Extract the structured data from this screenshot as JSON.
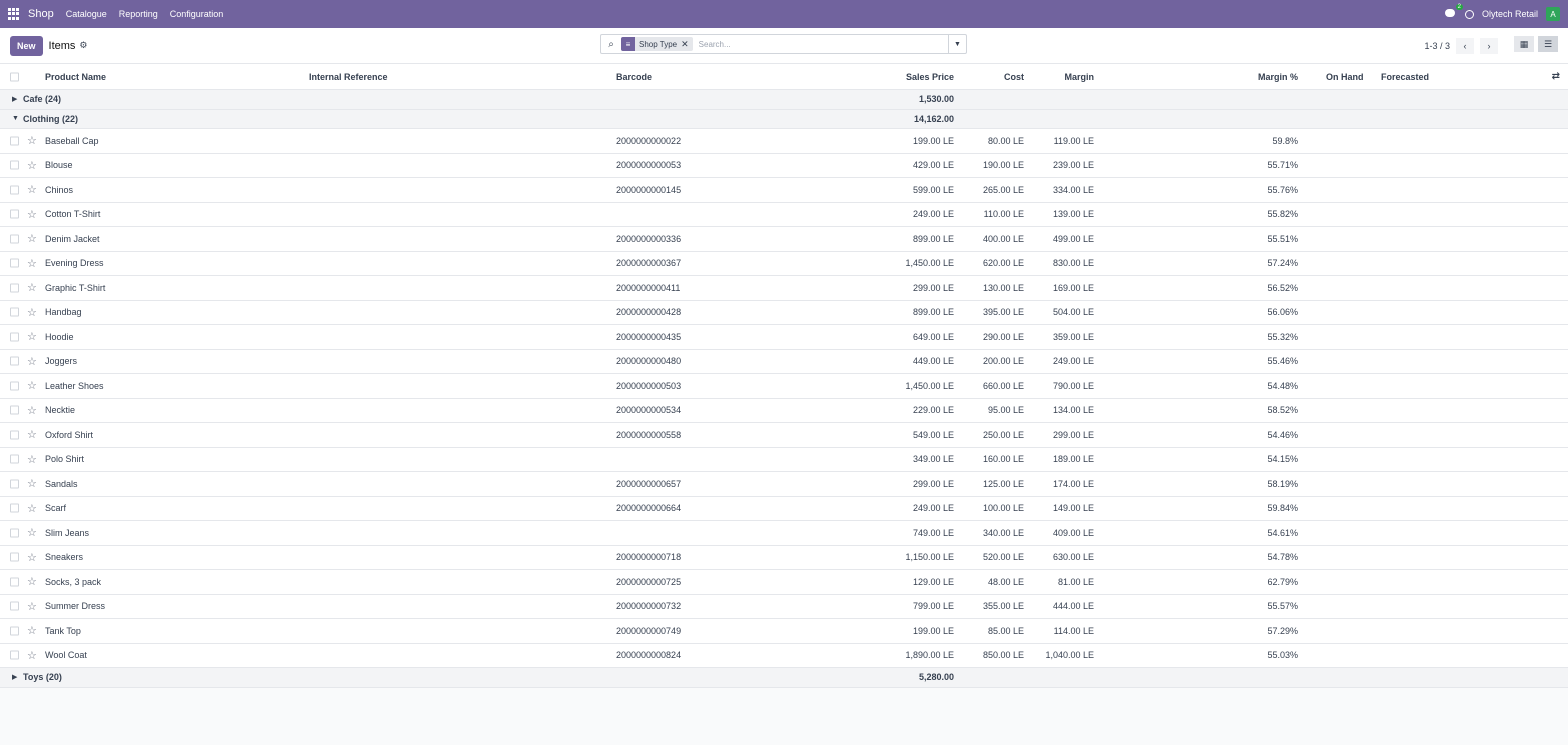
{
  "topbar": {
    "brand": "Shop",
    "menus": [
      "Catalogue",
      "Reporting",
      "Configuration"
    ],
    "chat_count": "2",
    "company": "Olytech Retail",
    "avatar_letter": "A"
  },
  "control": {
    "new_label": "New",
    "title": "Items",
    "facet_label": "Shop Type",
    "search_placeholder": "Search...",
    "pager": "1-3 / 3"
  },
  "columns": {
    "name": "Product Name",
    "ref": "Internal Reference",
    "barcode": "Barcode",
    "price": "Sales Price",
    "cost": "Cost",
    "margin": "Margin",
    "mpct": "Margin %",
    "onhand": "On Hand",
    "forecasted": "Forecasted"
  },
  "groups": [
    {
      "label": "Cafe (24)",
      "total": "1,530.00",
      "expanded": false
    },
    {
      "label": "Clothing (22)",
      "total": "14,162.00",
      "expanded": true
    },
    {
      "label": "Toys (20)",
      "total": "5,280.00",
      "expanded": false
    }
  ],
  "rows": [
    {
      "name": "Baseball Cap",
      "barcode": "2000000000022",
      "price": "199.00 LE",
      "cost": "80.00 LE",
      "margin": "119.00 LE",
      "mpct": "59.8%"
    },
    {
      "name": "Blouse",
      "barcode": "2000000000053",
      "price": "429.00 LE",
      "cost": "190.00 LE",
      "margin": "239.00 LE",
      "mpct": "55.71%"
    },
    {
      "name": "Chinos",
      "barcode": "2000000000145",
      "price": "599.00 LE",
      "cost": "265.00 LE",
      "margin": "334.00 LE",
      "mpct": "55.76%"
    },
    {
      "name": "Cotton T-Shirt",
      "barcode": "",
      "price": "249.00 LE",
      "cost": "110.00 LE",
      "margin": "139.00 LE",
      "mpct": "55.82%"
    },
    {
      "name": "Denim Jacket",
      "barcode": "2000000000336",
      "price": "899.00 LE",
      "cost": "400.00 LE",
      "margin": "499.00 LE",
      "mpct": "55.51%"
    },
    {
      "name": "Evening Dress",
      "barcode": "2000000000367",
      "price": "1,450.00 LE",
      "cost": "620.00 LE",
      "margin": "830.00 LE",
      "mpct": "57.24%"
    },
    {
      "name": "Graphic T-Shirt",
      "barcode": "2000000000411",
      "price": "299.00 LE",
      "cost": "130.00 LE",
      "margin": "169.00 LE",
      "mpct": "56.52%"
    },
    {
      "name": "Handbag",
      "barcode": "2000000000428",
      "price": "899.00 LE",
      "cost": "395.00 LE",
      "margin": "504.00 LE",
      "mpct": "56.06%"
    },
    {
      "name": "Hoodie",
      "barcode": "2000000000435",
      "price": "649.00 LE",
      "cost": "290.00 LE",
      "margin": "359.00 LE",
      "mpct": "55.32%"
    },
    {
      "name": "Joggers",
      "barcode": "2000000000480",
      "price": "449.00 LE",
      "cost": "200.00 LE",
      "margin": "249.00 LE",
      "mpct": "55.46%"
    },
    {
      "name": "Leather Shoes",
      "barcode": "2000000000503",
      "price": "1,450.00 LE",
      "cost": "660.00 LE",
      "margin": "790.00 LE",
      "mpct": "54.48%"
    },
    {
      "name": "Necktie",
      "barcode": "2000000000534",
      "price": "229.00 LE",
      "cost": "95.00 LE",
      "margin": "134.00 LE",
      "mpct": "58.52%"
    },
    {
      "name": "Oxford Shirt",
      "barcode": "2000000000558",
      "price": "549.00 LE",
      "cost": "250.00 LE",
      "margin": "299.00 LE",
      "mpct": "54.46%"
    },
    {
      "name": "Polo Shirt",
      "barcode": "",
      "price": "349.00 LE",
      "cost": "160.00 LE",
      "margin": "189.00 LE",
      "mpct": "54.15%"
    },
    {
      "name": "Sandals",
      "barcode": "2000000000657",
      "price": "299.00 LE",
      "cost": "125.00 LE",
      "margin": "174.00 LE",
      "mpct": "58.19%"
    },
    {
      "name": "Scarf",
      "barcode": "2000000000664",
      "price": "249.00 LE",
      "cost": "100.00 LE",
      "margin": "149.00 LE",
      "mpct": "59.84%"
    },
    {
      "name": "Slim Jeans",
      "barcode": "",
      "price": "749.00 LE",
      "cost": "340.00 LE",
      "margin": "409.00 LE",
      "mpct": "54.61%"
    },
    {
      "name": "Sneakers",
      "barcode": "2000000000718",
      "price": "1,150.00 LE",
      "cost": "520.00 LE",
      "margin": "630.00 LE",
      "mpct": "54.78%"
    },
    {
      "name": "Socks, 3 pack",
      "barcode": "2000000000725",
      "price": "129.00 LE",
      "cost": "48.00 LE",
      "margin": "81.00 LE",
      "mpct": "62.79%"
    },
    {
      "name": "Summer Dress",
      "barcode": "2000000000732",
      "price": "799.00 LE",
      "cost": "355.00 LE",
      "margin": "444.00 LE",
      "mpct": "55.57%"
    },
    {
      "name": "Tank Top",
      "barcode": "2000000000749",
      "price": "199.00 LE",
      "cost": "85.00 LE",
      "margin": "114.00 LE",
      "mpct": "57.29%"
    },
    {
      "name": "Wool Coat",
      "barcode": "2000000000824",
      "price": "1,890.00 LE",
      "cost": "850.00 LE",
      "margin": "1,040.00 LE",
      "mpct": "55.03%"
    }
  ]
}
